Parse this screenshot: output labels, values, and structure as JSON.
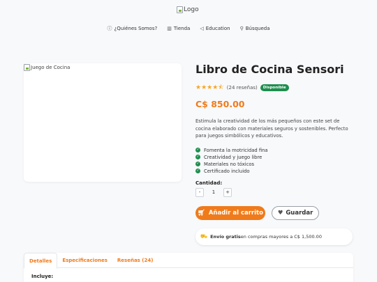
{
  "header": {
    "logo_alt": "Logo",
    "nav": [
      {
        "label": "¿Quiénes Somos?",
        "icon": "info-circle-icon"
      },
      {
        "label": "Tienda",
        "icon": "store-icon"
      },
      {
        "label": "Education",
        "icon": "megaphone-icon"
      },
      {
        "label": "Búsqueda",
        "icon": "search-icon"
      }
    ]
  },
  "product": {
    "image_alt": "Juego de Cocina",
    "title": "Libro de Cocina Sensori",
    "rating": 4.5,
    "reviews": "(24 reseñas)",
    "availability": "Disponible",
    "price": "C$ 850.00",
    "description": "Estimula la creatividad de los más pequeños con este set de cocina elaborado con materiales seguros y sostenibles. Perfecto para juegos simbólicos y educativos.",
    "features": [
      "Fomenta la motricidad fina",
      "Creatividad y juego libre",
      "Materiales no tóxicos",
      "Certificado incluido"
    ],
    "quantity_label": "Cantidad:",
    "quantity": "1",
    "minus": "-",
    "plus": "+",
    "add_to_cart": "Añadir al carrito",
    "save": "Guardar",
    "shipping_bold": "Envío gratis",
    "shipping_rest": "en compras mayores a C$ 1,500.00"
  },
  "tabs": [
    {
      "label": "Detalles",
      "active": true
    },
    {
      "label": "Especificaciones",
      "active": false
    },
    {
      "label": "Reseñas (24)",
      "active": false
    }
  ],
  "details": {
    "includes_label": "Incluye:"
  },
  "colors": {
    "accent": "#f07b1a",
    "success": "#1e8e4e",
    "star": "#f5a623"
  }
}
